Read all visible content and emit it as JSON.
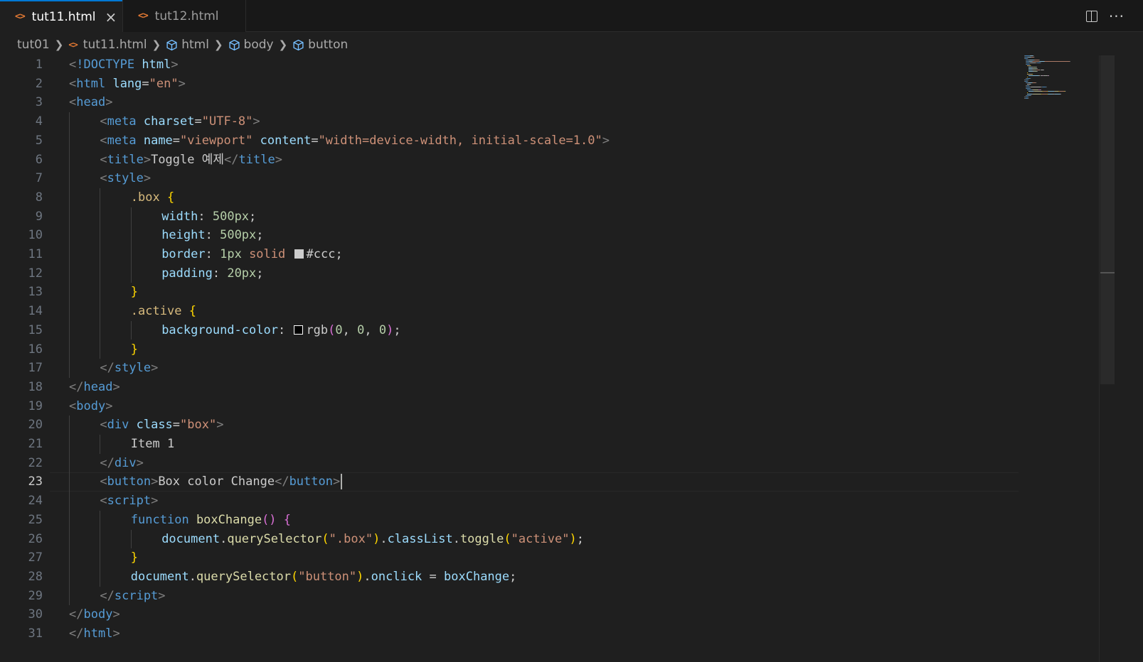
{
  "tabs": [
    {
      "label": "tut11.html",
      "icon": "html-file-icon",
      "active": true
    },
    {
      "label": "tut12.html",
      "icon": "html-file-icon",
      "active": false
    }
  ],
  "toolbar": {
    "split_icon": "split-editor-icon",
    "more_icon": "more-actions-icon"
  },
  "breadcrumb": [
    "tut01",
    "tut11.html",
    "html",
    "body",
    "button"
  ],
  "editor": {
    "cursor_line": 23,
    "lines": [
      {
        "n": "1",
        "indent": 0,
        "tokens": [
          [
            "t",
            "<"
          ],
          [
            "tn",
            "!DOCTYPE"
          ],
          [
            "pl",
            " "
          ],
          [
            "an",
            "html"
          ],
          [
            "t",
            ">"
          ]
        ]
      },
      {
        "n": "2",
        "indent": 0,
        "tokens": [
          [
            "t",
            "<"
          ],
          [
            "tn",
            "html"
          ],
          [
            "pl",
            " "
          ],
          [
            "an",
            "lang"
          ],
          [
            "pl",
            "="
          ],
          [
            "s",
            "\"en\""
          ],
          [
            "t",
            ">"
          ]
        ]
      },
      {
        "n": "3",
        "indent": 0,
        "tokens": [
          [
            "t",
            "<"
          ],
          [
            "tn",
            "head"
          ],
          [
            "t",
            ">"
          ]
        ]
      },
      {
        "n": "4",
        "indent": 1,
        "tokens": [
          [
            "t",
            "<"
          ],
          [
            "tn",
            "meta"
          ],
          [
            "pl",
            " "
          ],
          [
            "an",
            "charset"
          ],
          [
            "pl",
            "="
          ],
          [
            "s",
            "\"UTF-8\""
          ],
          [
            "t",
            ">"
          ]
        ]
      },
      {
        "n": "5",
        "indent": 1,
        "tokens": [
          [
            "t",
            "<"
          ],
          [
            "tn",
            "meta"
          ],
          [
            "pl",
            " "
          ],
          [
            "an",
            "name"
          ],
          [
            "pl",
            "="
          ],
          [
            "s",
            "\"viewport\""
          ],
          [
            "pl",
            " "
          ],
          [
            "an",
            "content"
          ],
          [
            "pl",
            "="
          ],
          [
            "s",
            "\"width=device-width, initial-scale=1.0\""
          ],
          [
            "t",
            ">"
          ]
        ]
      },
      {
        "n": "6",
        "indent": 1,
        "tokens": [
          [
            "t",
            "<"
          ],
          [
            "tn",
            "title"
          ],
          [
            "t",
            ">"
          ],
          [
            "pl",
            "Toggle 예제"
          ],
          [
            "t",
            "</"
          ],
          [
            "tn",
            "title"
          ],
          [
            "t",
            ">"
          ]
        ]
      },
      {
        "n": "7",
        "indent": 1,
        "tokens": [
          [
            "t",
            "<"
          ],
          [
            "tn",
            "style"
          ],
          [
            "t",
            ">"
          ]
        ]
      },
      {
        "n": "8",
        "indent": 2,
        "tokens": [
          [
            "sel",
            ".box"
          ],
          [
            "pl",
            " "
          ],
          [
            "br",
            "{"
          ]
        ]
      },
      {
        "n": "9",
        "indent": 3,
        "tokens": [
          [
            "an",
            "width"
          ],
          [
            "pl",
            ": "
          ],
          [
            "n",
            "500px"
          ],
          [
            "pl",
            ";"
          ]
        ]
      },
      {
        "n": "10",
        "indent": 3,
        "tokens": [
          [
            "an",
            "height"
          ],
          [
            "pl",
            ": "
          ],
          [
            "n",
            "500px"
          ],
          [
            "pl",
            ";"
          ]
        ]
      },
      {
        "n": "11",
        "indent": 3,
        "tokens": [
          [
            "an",
            "border"
          ],
          [
            "pl",
            ": "
          ],
          [
            "n",
            "1px"
          ],
          [
            "pl",
            " "
          ],
          [
            "s",
            "solid"
          ],
          [
            "pl",
            " "
          ],
          [
            "swatch",
            "#cccccc"
          ],
          [
            "pl",
            "#ccc;"
          ]
        ]
      },
      {
        "n": "12",
        "indent": 3,
        "tokens": [
          [
            "an",
            "padding"
          ],
          [
            "pl",
            ": "
          ],
          [
            "n",
            "20px"
          ],
          [
            "pl",
            ";"
          ]
        ]
      },
      {
        "n": "13",
        "indent": 2,
        "tokens": [
          [
            "br",
            "}"
          ]
        ]
      },
      {
        "n": "14",
        "indent": 2,
        "tokens": [
          [
            "sel",
            ".active"
          ],
          [
            "pl",
            " "
          ],
          [
            "br",
            "{"
          ]
        ]
      },
      {
        "n": "15",
        "indent": 3,
        "tokens": [
          [
            "an",
            "background-color"
          ],
          [
            "pl",
            ": "
          ],
          [
            "swatch",
            "#000000"
          ],
          [
            "pl",
            "rgb"
          ],
          [
            "br2",
            "("
          ],
          [
            "n",
            "0"
          ],
          [
            "pl",
            ", "
          ],
          [
            "n",
            "0"
          ],
          [
            "pl",
            ", "
          ],
          [
            "n",
            "0"
          ],
          [
            "br2",
            ")"
          ],
          [
            "pl",
            ";"
          ]
        ]
      },
      {
        "n": "16",
        "indent": 2,
        "tokens": [
          [
            "br",
            "}"
          ]
        ]
      },
      {
        "n": "17",
        "indent": 1,
        "tokens": [
          [
            "t",
            "</"
          ],
          [
            "tn",
            "style"
          ],
          [
            "t",
            ">"
          ]
        ]
      },
      {
        "n": "18",
        "indent": 0,
        "tokens": [
          [
            "t",
            "</"
          ],
          [
            "tn",
            "head"
          ],
          [
            "t",
            ">"
          ]
        ]
      },
      {
        "n": "19",
        "indent": 0,
        "tokens": [
          [
            "t",
            "<"
          ],
          [
            "tn",
            "body"
          ],
          [
            "t",
            ">"
          ]
        ]
      },
      {
        "n": "20",
        "indent": 1,
        "tokens": [
          [
            "t",
            "<"
          ],
          [
            "tn",
            "div"
          ],
          [
            "pl",
            " "
          ],
          [
            "an",
            "class"
          ],
          [
            "pl",
            "="
          ],
          [
            "s",
            "\"box\""
          ],
          [
            "t",
            ">"
          ]
        ]
      },
      {
        "n": "21",
        "indent": 2,
        "tokens": [
          [
            "pl",
            "Item 1"
          ]
        ]
      },
      {
        "n": "22",
        "indent": 1,
        "tokens": [
          [
            "t",
            "</"
          ],
          [
            "tn",
            "div"
          ],
          [
            "t",
            ">"
          ]
        ]
      },
      {
        "n": "23",
        "indent": 1,
        "tokens": [
          [
            "t",
            "<"
          ],
          [
            "tn",
            "button"
          ],
          [
            "t",
            ">"
          ],
          [
            "pl",
            "Box color Change"
          ],
          [
            "t",
            "</"
          ],
          [
            "tn",
            "button"
          ],
          [
            "t",
            ">"
          ],
          [
            "caret",
            ""
          ]
        ]
      },
      {
        "n": "24",
        "indent": 1,
        "tokens": [
          [
            "t",
            "<"
          ],
          [
            "tn",
            "script"
          ],
          [
            "t",
            ">"
          ]
        ]
      },
      {
        "n": "25",
        "indent": 2,
        "tokens": [
          [
            "kw",
            "function"
          ],
          [
            "pl",
            " "
          ],
          [
            "fn",
            "boxChange"
          ],
          [
            "br2",
            "()"
          ],
          [
            "pl",
            " "
          ],
          [
            "br2",
            "{"
          ]
        ]
      },
      {
        "n": "26",
        "indent": 3,
        "tokens": [
          [
            "v",
            "document"
          ],
          [
            "pl",
            "."
          ],
          [
            "fn",
            "querySelector"
          ],
          [
            "br",
            "("
          ],
          [
            "s",
            "\".box\""
          ],
          [
            "br",
            ")"
          ],
          [
            "pl",
            "."
          ],
          [
            "v",
            "classList"
          ],
          [
            "pl",
            "."
          ],
          [
            "fn",
            "toggle"
          ],
          [
            "br",
            "("
          ],
          [
            "s",
            "\"active\""
          ],
          [
            "br",
            ")"
          ],
          [
            "pl",
            ";"
          ]
        ]
      },
      {
        "n": "27",
        "indent": 2,
        "tokens": [
          [
            "br",
            "}"
          ]
        ]
      },
      {
        "n": "28",
        "indent": 2,
        "tokens": [
          [
            "v",
            "document"
          ],
          [
            "pl",
            "."
          ],
          [
            "fn",
            "querySelector"
          ],
          [
            "br",
            "("
          ],
          [
            "s",
            "\"button\""
          ],
          [
            "br",
            ")"
          ],
          [
            "pl",
            "."
          ],
          [
            "v",
            "onclick"
          ],
          [
            "pl",
            " = "
          ],
          [
            "v",
            "boxChange"
          ],
          [
            "pl",
            ";"
          ]
        ]
      },
      {
        "n": "29",
        "indent": 1,
        "tokens": [
          [
            "t",
            "</"
          ],
          [
            "tn",
            "script"
          ],
          [
            "t",
            ">"
          ]
        ]
      },
      {
        "n": "30",
        "indent": 0,
        "tokens": [
          [
            "t",
            "</"
          ],
          [
            "tn",
            "body"
          ],
          [
            "t",
            ">"
          ]
        ]
      },
      {
        "n": "31",
        "indent": 0,
        "tokens": [
          [
            "t",
            "</"
          ],
          [
            "tn",
            "html"
          ],
          [
            "t",
            ">"
          ]
        ]
      }
    ]
  }
}
